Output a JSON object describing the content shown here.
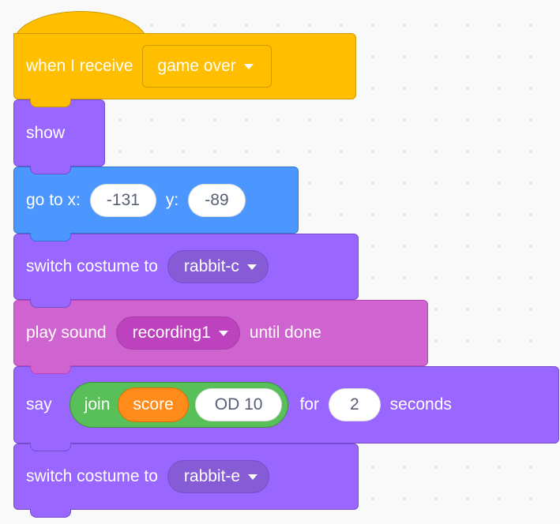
{
  "colors": {
    "events": "#ffbf00",
    "looks": "#9966ff",
    "looks_dropdown": "#855cd6",
    "motion": "#4c97ff",
    "sound": "#cf63cf",
    "sound_dropdown": "#bd42bd",
    "operators": "#59c059",
    "variables": "#ff8c1a"
  },
  "script": {
    "hat": {
      "label": "when I receive",
      "dropdown": "game over"
    },
    "show": {
      "label": "show"
    },
    "goto": {
      "label_x": "go to x:",
      "x_value": "-131",
      "label_y": "y:",
      "y_value": "-89"
    },
    "switch1": {
      "label": "switch costume to",
      "dropdown": "rabbit-c"
    },
    "play_sound": {
      "label": "play sound",
      "dropdown": "recording1",
      "suffix": "until done"
    },
    "say": {
      "label": "say",
      "join_label": "join",
      "variable": "score",
      "text_value": "OD 10",
      "for_label": "for",
      "seconds_value": "2",
      "seconds_label": "seconds"
    },
    "switch2": {
      "label": "switch costume to",
      "dropdown": "rabbit-e"
    }
  }
}
